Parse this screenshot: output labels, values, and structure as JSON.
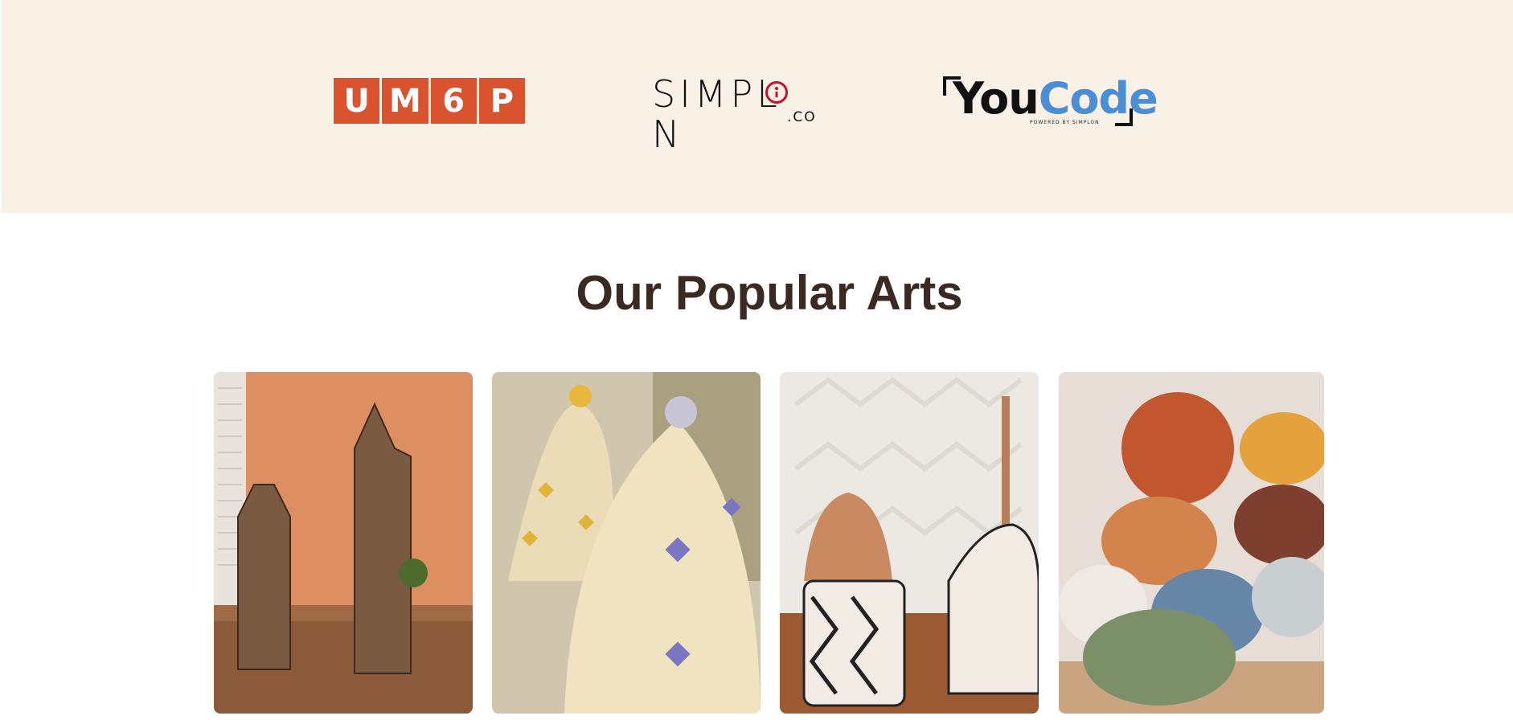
{
  "partners": {
    "um6p": {
      "letters": [
        "U",
        "M",
        "6",
        "P"
      ],
      "color": "#d9532f"
    },
    "simplon": {
      "word_left": "SIMPL",
      "word_right": "N",
      "suffix": ".CO",
      "accent": "#c8102e"
    },
    "youcode": {
      "part1": "You",
      "part2": "Code",
      "tagline": "POWERED BY SIMPLON",
      "accent": "#4a8ed6"
    }
  },
  "section": {
    "title": "Our Popular Arts"
  },
  "arts": [
    {
      "icon": "lanterns-image"
    },
    {
      "icon": "baskets-image"
    },
    {
      "icon": "ceramics-image"
    },
    {
      "icon": "poufs-image"
    }
  ],
  "colors": {
    "partners_bg": "#f9f1e6",
    "title": "#3a2a22"
  }
}
